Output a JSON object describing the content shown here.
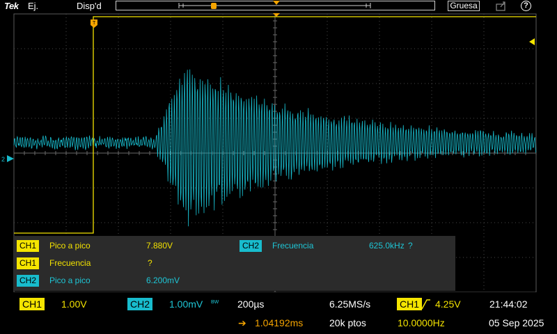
{
  "top_bar": {
    "brand": "Tek",
    "mode": "Ej.",
    "state": "Disp'd",
    "acquire_label": "Gruesa",
    "help_glyph": "?",
    "save_icon": "save-export-icon",
    "help_icon": "help-icon"
  },
  "colors": {
    "ch1": "#f5e500",
    "ch2": "#18bccd",
    "trigger": "#f5a400",
    "grid": "#5a5a5a",
    "panel": "#2b2b2b"
  },
  "markers": {
    "trigger_position_label": "T",
    "ch2_ground_label": "2"
  },
  "measurements": [
    {
      "channel": "CH1",
      "name": "Pico a pico",
      "value": "7.880V"
    },
    {
      "channel": "CH2",
      "name": "Frecuencia",
      "value": "625.0kHz",
      "flag": "?"
    },
    {
      "channel": "CH1",
      "name": "Frecuencia",
      "value": "?"
    },
    {
      "channel": "CH2",
      "name": "Pico a pico",
      "value": "6.200mV"
    }
  ],
  "status": {
    "ch1_label": "CH1",
    "ch1_scale": "1.00V",
    "ch2_label": "CH2",
    "ch2_scale": "1.00mV",
    "bw_limit": "BW",
    "timebase": "200µs",
    "sample_rate": "6.25MS/s",
    "trigger_source": "CH1",
    "trigger_level": "4.25V",
    "time": "21:44:02",
    "trigger_offset_arrow": "➔",
    "trigger_offset": "1.04192ms",
    "record_length": "20k ptos",
    "trigger_frequency": "10.0000Hz",
    "date": "05 Sep 2025"
  }
}
